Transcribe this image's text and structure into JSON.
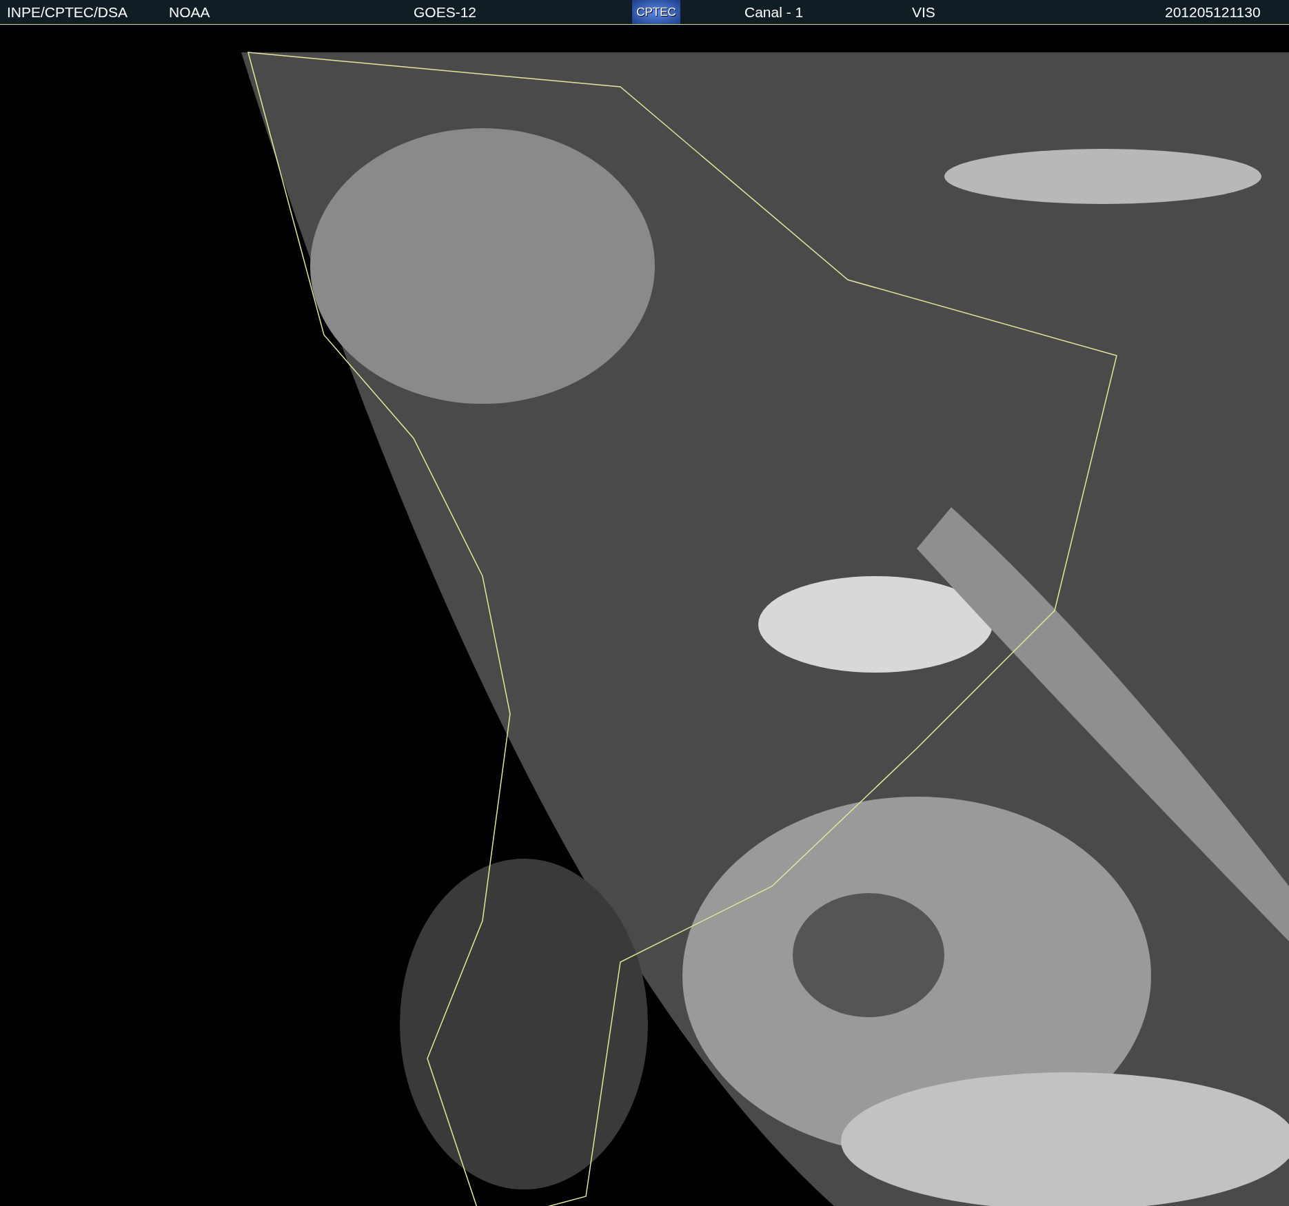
{
  "header": {
    "items": [
      {
        "kind": "text",
        "text": "INPE/CPTEC/DSA"
      },
      {
        "kind": "text",
        "text": "NOAA"
      },
      {
        "kind": "text",
        "text": "GOES-12"
      },
      {
        "kind": "logo",
        "text": "CPTEC"
      },
      {
        "kind": "text",
        "text": "Canal - 1"
      },
      {
        "kind": "text",
        "text": "VIS"
      },
      {
        "kind": "text",
        "text": "201205121130"
      }
    ]
  }
}
